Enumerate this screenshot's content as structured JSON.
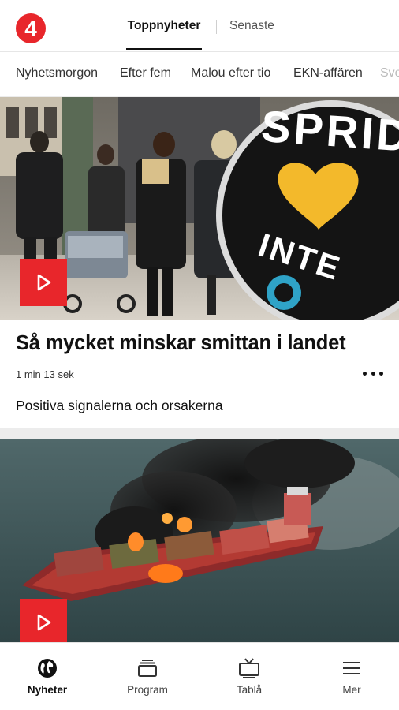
{
  "header": {
    "logo_text": "4",
    "tabs": [
      {
        "label": "Toppnyheter",
        "active": true
      },
      {
        "label": "Senaste",
        "active": false
      }
    ]
  },
  "program_chips": [
    "Nyhetsmorgon",
    "Efter fem",
    "Malou efter tio",
    "EKN-affären",
    "Sve"
  ],
  "articles": [
    {
      "title": "Så mycket minskar smittan i landet",
      "duration": "1 min 13 sek",
      "subtitle": "Positiva signalerna och orsakerna",
      "image_sign_text": [
        "SPRID",
        "INTE"
      ]
    },
    {
      "title": "",
      "duration": "",
      "subtitle": ""
    }
  ],
  "bottom_nav": [
    {
      "label": "Nyheter",
      "icon": "globe-icon",
      "active": true
    },
    {
      "label": "Program",
      "icon": "program-stack-icon",
      "active": false
    },
    {
      "label": "Tablå",
      "icon": "tv-icon",
      "active": false
    },
    {
      "label": "Mer",
      "icon": "menu-icon",
      "active": false
    }
  ],
  "colors": {
    "brand_red": "#e8262b",
    "text": "#111111",
    "divider": "#ececec"
  }
}
